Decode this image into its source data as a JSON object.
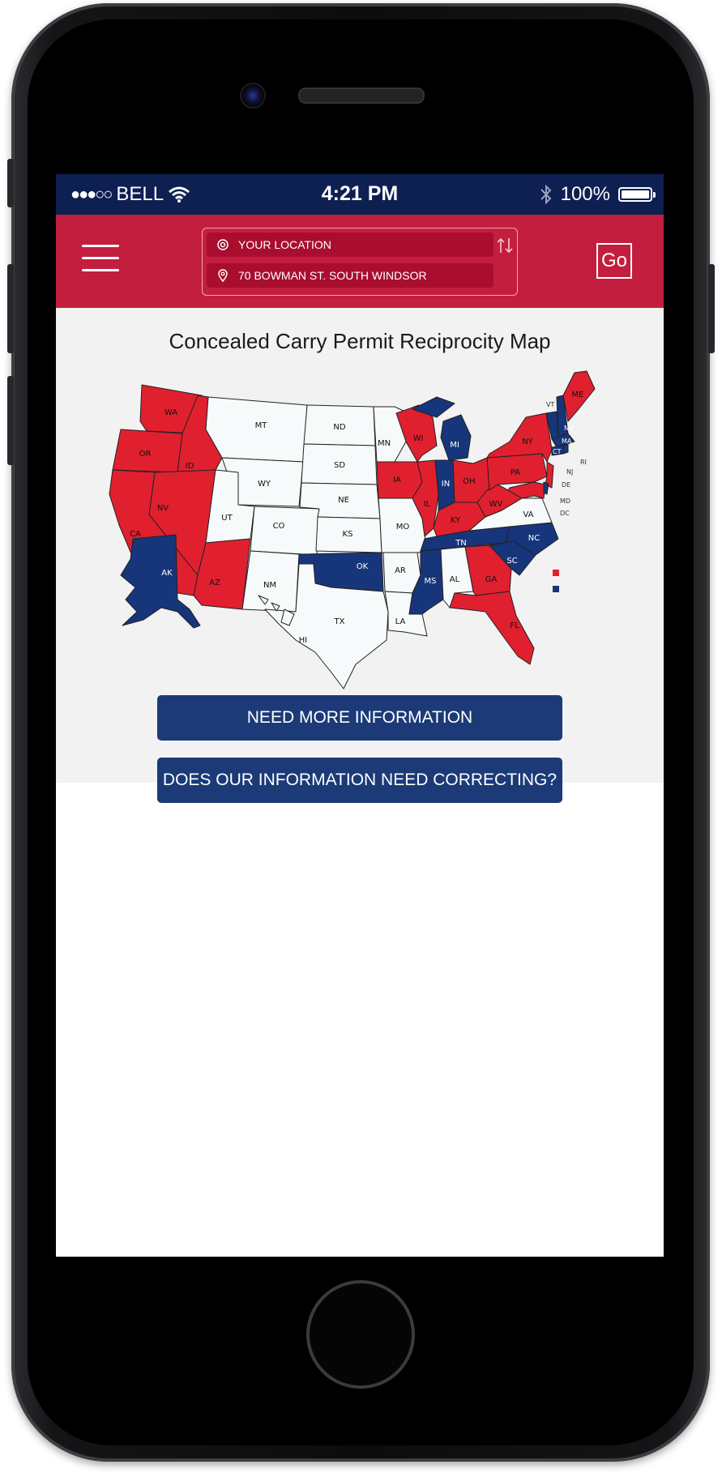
{
  "colors": {
    "red_states": "#e0202f",
    "blue_states": "#17357a",
    "white_states": "#f7fafb",
    "header": "#c41e3e",
    "status_bar": "#0e1f52",
    "button": "#1b3a77"
  },
  "status_bar": {
    "signal": "●●●○○",
    "carrier": "BELL",
    "time": "4:21 PM",
    "battery": "100%"
  },
  "header": {
    "origin": "YOUR LOCATION",
    "destination": "70 BOWMAN ST.  SOUTH WINDSOR",
    "go_label": "Go"
  },
  "page": {
    "title": "Concealed Carry Permit Reciprocity Map"
  },
  "map": {
    "state_labels": [
      "WA",
      "OR",
      "CA",
      "ID",
      "NV",
      "MT",
      "WY",
      "UT",
      "AZ",
      "CO",
      "NM",
      "ND",
      "SD",
      "NE",
      "KS",
      "OK",
      "TX",
      "MN",
      "IA",
      "MO",
      "AR",
      "LA",
      "WI",
      "IL",
      "MI",
      "IN",
      "OH",
      "KY",
      "TN",
      "MS",
      "AL",
      "GA",
      "FL",
      "SC",
      "NC",
      "VA",
      "WV",
      "PA",
      "NY",
      "ME",
      "VT",
      "NH",
      "MA",
      "CT",
      "RI",
      "NJ",
      "DE",
      "MD",
      "DC",
      "AK",
      "HI"
    ],
    "red_states": [
      "WA",
      "OR",
      "CA",
      "ID",
      "NV",
      "AZ",
      "IA",
      "WI",
      "IL",
      "OH",
      "KY",
      "WV",
      "PA",
      "NY",
      "GA",
      "FL",
      "ME",
      "NJ",
      "MD"
    ],
    "blue_states": [
      "AK",
      "OK",
      "MI",
      "IN",
      "TN",
      "MS",
      "SC",
      "NC",
      "VT",
      "NH",
      "MA",
      "CT",
      "RI",
      "DE"
    ]
  },
  "buttons": {
    "more_info": "NEED MORE INFORMATION",
    "correction": "DOES OUR INFORMATION NEED CORRECTING?"
  }
}
